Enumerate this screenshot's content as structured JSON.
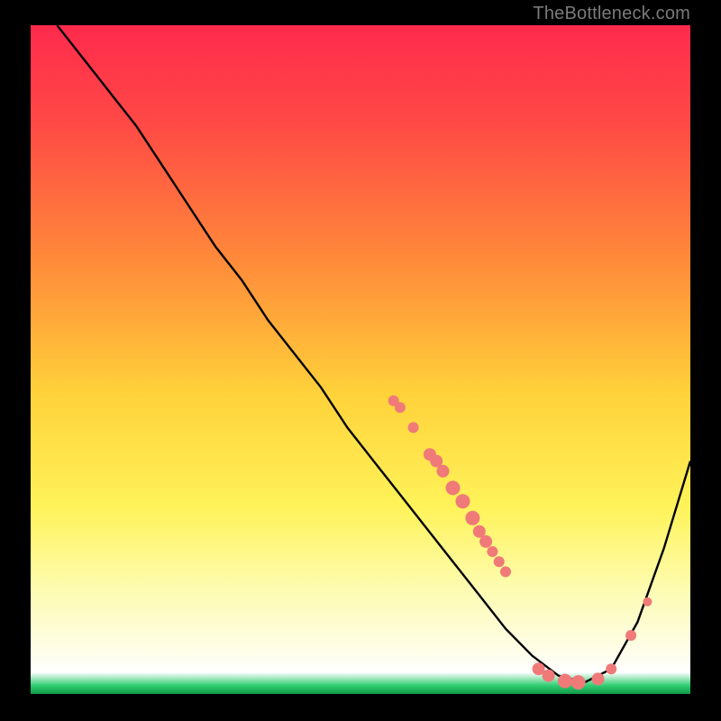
{
  "watermark": "TheBottleneck.com",
  "chart_data": {
    "type": "line",
    "title": "",
    "xlabel": "",
    "ylabel": "",
    "xlim": [
      0,
      100
    ],
    "ylim": [
      0,
      100
    ],
    "grid": false,
    "legend": false,
    "gradient_stops": [
      {
        "offset": 0.0,
        "color": "#ff2a4d"
      },
      {
        "offset": 0.15,
        "color": "#ff4a45"
      },
      {
        "offset": 0.35,
        "color": "#ff8a3a"
      },
      {
        "offset": 0.55,
        "color": "#ffd23a"
      },
      {
        "offset": 0.72,
        "color": "#fff35a"
      },
      {
        "offset": 0.84,
        "color": "#fdfcb0"
      },
      {
        "offset": 0.92,
        "color": "#fefde0"
      },
      {
        "offset": 0.965,
        "color": "#ffffff"
      },
      {
        "offset": 0.985,
        "color": "#2ecc71"
      },
      {
        "offset": 1.0,
        "color": "#0a8f3c"
      }
    ],
    "series": [
      {
        "name": "bottleneck-curve",
        "color": "#000000",
        "x": [
          4,
          8,
          12,
          16,
          20,
          24,
          28,
          32,
          36,
          40,
          44,
          48,
          52,
          56,
          60,
          64,
          68,
          72,
          76,
          80,
          84,
          88,
          92,
          96,
          100
        ],
        "y": [
          100,
          95,
          90,
          85,
          79,
          73,
          67,
          62,
          56,
          51,
          46,
          40,
          35,
          30,
          25,
          20,
          15,
          10,
          6,
          3,
          2,
          4,
          11,
          22,
          35
        ]
      }
    ],
    "markers": {
      "name": "highlight-points",
      "color": "#f07a78",
      "radius_default": 6,
      "points": [
        {
          "x": 55,
          "y": 44,
          "r": 6
        },
        {
          "x": 56,
          "y": 43,
          "r": 6
        },
        {
          "x": 58,
          "y": 40,
          "r": 6
        },
        {
          "x": 60.5,
          "y": 36,
          "r": 7
        },
        {
          "x": 61.5,
          "y": 35,
          "r": 7
        },
        {
          "x": 62.5,
          "y": 33.5,
          "r": 7
        },
        {
          "x": 64,
          "y": 31,
          "r": 8
        },
        {
          "x": 65.5,
          "y": 29,
          "r": 8
        },
        {
          "x": 67,
          "y": 26.5,
          "r": 8
        },
        {
          "x": 68,
          "y": 24.5,
          "r": 7
        },
        {
          "x": 69,
          "y": 23,
          "r": 7
        },
        {
          "x": 70,
          "y": 21.5,
          "r": 6
        },
        {
          "x": 71,
          "y": 20,
          "r": 6
        },
        {
          "x": 72,
          "y": 18.5,
          "r": 6
        },
        {
          "x": 77,
          "y": 4,
          "r": 7
        },
        {
          "x": 78.5,
          "y": 3,
          "r": 7
        },
        {
          "x": 81,
          "y": 2.2,
          "r": 8
        },
        {
          "x": 83,
          "y": 2,
          "r": 8
        },
        {
          "x": 86,
          "y": 2.5,
          "r": 7
        },
        {
          "x": 88,
          "y": 4,
          "r": 6
        },
        {
          "x": 91,
          "y": 9,
          "r": 6
        },
        {
          "x": 93.5,
          "y": 14,
          "r": 5
        }
      ]
    }
  }
}
